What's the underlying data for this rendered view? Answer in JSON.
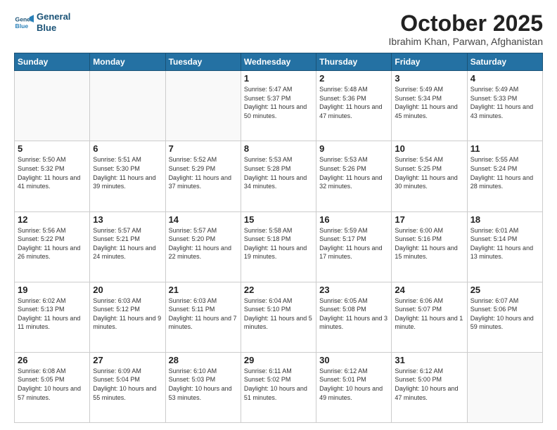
{
  "header": {
    "logo_line1": "General",
    "logo_line2": "Blue",
    "month": "October 2025",
    "location": "Ibrahim Khan, Parwan, Afghanistan"
  },
  "weekdays": [
    "Sunday",
    "Monday",
    "Tuesday",
    "Wednesday",
    "Thursday",
    "Friday",
    "Saturday"
  ],
  "weeks": [
    [
      {
        "day": "",
        "info": ""
      },
      {
        "day": "",
        "info": ""
      },
      {
        "day": "",
        "info": ""
      },
      {
        "day": "1",
        "info": "Sunrise: 5:47 AM\nSunset: 5:37 PM\nDaylight: 11 hours\nand 50 minutes."
      },
      {
        "day": "2",
        "info": "Sunrise: 5:48 AM\nSunset: 5:36 PM\nDaylight: 11 hours\nand 47 minutes."
      },
      {
        "day": "3",
        "info": "Sunrise: 5:49 AM\nSunset: 5:34 PM\nDaylight: 11 hours\nand 45 minutes."
      },
      {
        "day": "4",
        "info": "Sunrise: 5:49 AM\nSunset: 5:33 PM\nDaylight: 11 hours\nand 43 minutes."
      }
    ],
    [
      {
        "day": "5",
        "info": "Sunrise: 5:50 AM\nSunset: 5:32 PM\nDaylight: 11 hours\nand 41 minutes."
      },
      {
        "day": "6",
        "info": "Sunrise: 5:51 AM\nSunset: 5:30 PM\nDaylight: 11 hours\nand 39 minutes."
      },
      {
        "day": "7",
        "info": "Sunrise: 5:52 AM\nSunset: 5:29 PM\nDaylight: 11 hours\nand 37 minutes."
      },
      {
        "day": "8",
        "info": "Sunrise: 5:53 AM\nSunset: 5:28 PM\nDaylight: 11 hours\nand 34 minutes."
      },
      {
        "day": "9",
        "info": "Sunrise: 5:53 AM\nSunset: 5:26 PM\nDaylight: 11 hours\nand 32 minutes."
      },
      {
        "day": "10",
        "info": "Sunrise: 5:54 AM\nSunset: 5:25 PM\nDaylight: 11 hours\nand 30 minutes."
      },
      {
        "day": "11",
        "info": "Sunrise: 5:55 AM\nSunset: 5:24 PM\nDaylight: 11 hours\nand 28 minutes."
      }
    ],
    [
      {
        "day": "12",
        "info": "Sunrise: 5:56 AM\nSunset: 5:22 PM\nDaylight: 11 hours\nand 26 minutes."
      },
      {
        "day": "13",
        "info": "Sunrise: 5:57 AM\nSunset: 5:21 PM\nDaylight: 11 hours\nand 24 minutes."
      },
      {
        "day": "14",
        "info": "Sunrise: 5:57 AM\nSunset: 5:20 PM\nDaylight: 11 hours\nand 22 minutes."
      },
      {
        "day": "15",
        "info": "Sunrise: 5:58 AM\nSunset: 5:18 PM\nDaylight: 11 hours\nand 19 minutes."
      },
      {
        "day": "16",
        "info": "Sunrise: 5:59 AM\nSunset: 5:17 PM\nDaylight: 11 hours\nand 17 minutes."
      },
      {
        "day": "17",
        "info": "Sunrise: 6:00 AM\nSunset: 5:16 PM\nDaylight: 11 hours\nand 15 minutes."
      },
      {
        "day": "18",
        "info": "Sunrise: 6:01 AM\nSunset: 5:14 PM\nDaylight: 11 hours\nand 13 minutes."
      }
    ],
    [
      {
        "day": "19",
        "info": "Sunrise: 6:02 AM\nSunset: 5:13 PM\nDaylight: 11 hours\nand 11 minutes."
      },
      {
        "day": "20",
        "info": "Sunrise: 6:03 AM\nSunset: 5:12 PM\nDaylight: 11 hours\nand 9 minutes."
      },
      {
        "day": "21",
        "info": "Sunrise: 6:03 AM\nSunset: 5:11 PM\nDaylight: 11 hours\nand 7 minutes."
      },
      {
        "day": "22",
        "info": "Sunrise: 6:04 AM\nSunset: 5:10 PM\nDaylight: 11 hours\nand 5 minutes."
      },
      {
        "day": "23",
        "info": "Sunrise: 6:05 AM\nSunset: 5:08 PM\nDaylight: 11 hours\nand 3 minutes."
      },
      {
        "day": "24",
        "info": "Sunrise: 6:06 AM\nSunset: 5:07 PM\nDaylight: 11 hours\nand 1 minute."
      },
      {
        "day": "25",
        "info": "Sunrise: 6:07 AM\nSunset: 5:06 PM\nDaylight: 10 hours\nand 59 minutes."
      }
    ],
    [
      {
        "day": "26",
        "info": "Sunrise: 6:08 AM\nSunset: 5:05 PM\nDaylight: 10 hours\nand 57 minutes."
      },
      {
        "day": "27",
        "info": "Sunrise: 6:09 AM\nSunset: 5:04 PM\nDaylight: 10 hours\nand 55 minutes."
      },
      {
        "day": "28",
        "info": "Sunrise: 6:10 AM\nSunset: 5:03 PM\nDaylight: 10 hours\nand 53 minutes."
      },
      {
        "day": "29",
        "info": "Sunrise: 6:11 AM\nSunset: 5:02 PM\nDaylight: 10 hours\nand 51 minutes."
      },
      {
        "day": "30",
        "info": "Sunrise: 6:12 AM\nSunset: 5:01 PM\nDaylight: 10 hours\nand 49 minutes."
      },
      {
        "day": "31",
        "info": "Sunrise: 6:12 AM\nSunset: 5:00 PM\nDaylight: 10 hours\nand 47 minutes."
      },
      {
        "day": "",
        "info": ""
      }
    ]
  ]
}
